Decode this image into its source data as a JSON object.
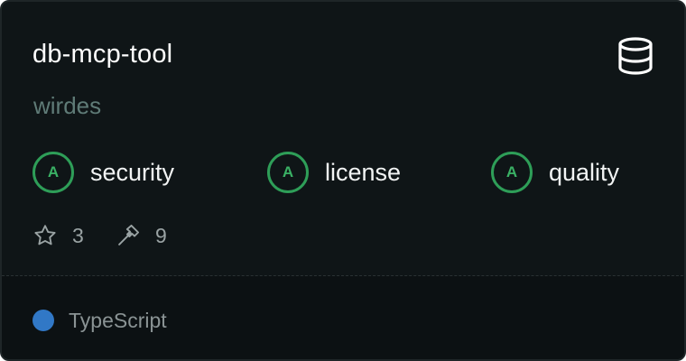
{
  "card": {
    "title": "db-mcp-tool",
    "owner": "wirdes",
    "type_icon": "database-icon"
  },
  "grades": [
    {
      "grade": "A",
      "label": "security"
    },
    {
      "grade": "A",
      "label": "license"
    },
    {
      "grade": "A",
      "label": "quality"
    }
  ],
  "stats": {
    "stars": "3",
    "star_icon": "star-icon",
    "tools": "9",
    "tools_icon": "hammer-icon"
  },
  "language": {
    "name": "TypeScript",
    "color": "#3178c6"
  },
  "colors": {
    "background": "#0f1517",
    "grade_accent": "#2e9e58",
    "owner_text": "#5f7b77"
  }
}
